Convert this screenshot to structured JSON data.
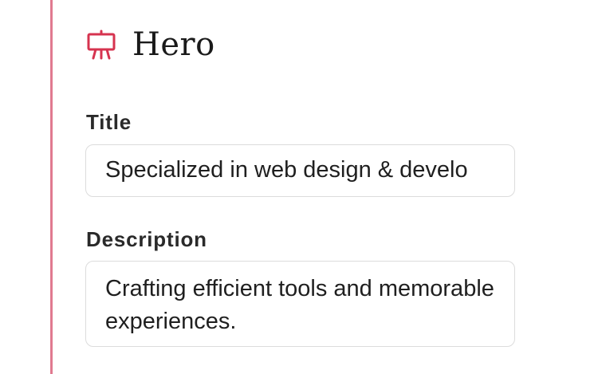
{
  "section": {
    "icon": "easel-icon",
    "title": "Hero"
  },
  "fields": {
    "title": {
      "label": "Title",
      "value": "Specialized in web design & develo"
    },
    "description": {
      "label": "Description",
      "value": "Crafting efficient tools and memorable experiences."
    }
  },
  "colors": {
    "accent": "#e07a90",
    "icon": "#d6334f"
  }
}
